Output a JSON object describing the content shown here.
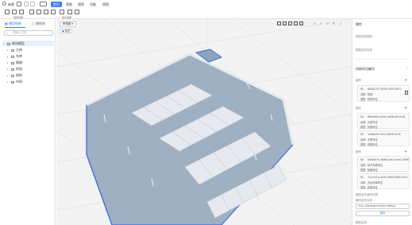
{
  "toolbar": {
    "first_item": "新建",
    "menus": [
      "首页",
      "视图",
      "搜索",
      "功能",
      "视图"
    ],
    "active_menu_index": 0,
    "group_labels": [
      "首页功能",
      "模式选择"
    ]
  },
  "left_panel": {
    "tabs": [
      "模型结构",
      "图纸库"
    ],
    "active_tab": 0,
    "search_placeholder": "请输入名称",
    "tree": [
      {
        "label": "地块模型",
        "level": 0,
        "selected": true
      },
      {
        "label": "主体",
        "level": 1
      },
      {
        "label": "车库",
        "level": 1
      },
      {
        "label": "楼梯",
        "level": 1
      },
      {
        "label": "机电",
        "level": 1
      },
      {
        "label": "结构",
        "level": 1
      },
      {
        "label": "市场",
        "level": 1
      }
    ]
  },
  "viewport": {
    "view_selector": "俯视图",
    "badge": "模型",
    "accent": "#3c6ee8",
    "floor_color": "#9fb0c2",
    "wall_color": "#e6e9ee"
  },
  "right_panel": {
    "title": "属性",
    "fields": [
      "模型结构编号",
      "模型结构名称"
    ],
    "section_title": "机械车位编号",
    "groups": [
      {
        "title": "编号",
        "cards": [
          {
            "id": "6b4d27f7-9026-4520-9d71",
            "name": "机械",
            "type": "机械车位"
          }
        ]
      },
      {
        "title": "编号",
        "cards": [
          {
            "id": "f8d0fe83-e2a0-4d48-b519-90",
            "name": "大型车位",
            "type": "机械车位"
          },
          {
            "id": "1e9be26-7a31-4856-9c78",
            "name": "中型车位",
            "type": "机械车位"
          }
        ]
      },
      {
        "title": "编号",
        "cards": [
          {
            "id": "694f4e70-3686-4bc1-bcd0-7696",
            "name": "地下车库车位",
            "type": "机械车位"
          },
          {
            "id": "7c1c2f7a-2e52-49d0-8f80-c55e",
            "name": "货运车库车位",
            "type": "机械车位"
          }
        ]
      }
    ],
    "bottom_label": "模型组件编号列表",
    "bottom_sub": "编号组件名称",
    "input_value": "75ea_f983694023296e7d5ffefb",
    "action_button": "保存",
    "footer_label": "模型结构"
  }
}
